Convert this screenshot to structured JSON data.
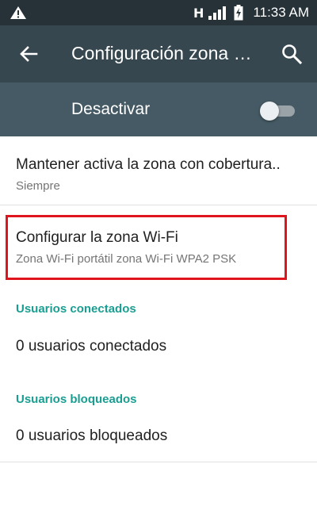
{
  "status_bar": {
    "network": "H",
    "time": "11:33 AM"
  },
  "app_bar": {
    "title": "Configuración zona Wi-Fi",
    "back_icon": "arrow-back-icon",
    "search_icon": "search-icon"
  },
  "hotspot_toggle": {
    "label": "Desactivar",
    "state": "off"
  },
  "preferences": {
    "keep_active": {
      "title": "Mantener activa la zona con cobertura..",
      "summary": "Siempre"
    },
    "configure": {
      "title": "Configurar la zona Wi-Fi",
      "summary": "Zona Wi-Fi portátil zona Wi-Fi WPA2 PSK",
      "highlight_color": "#e0141c"
    }
  },
  "connected": {
    "header": "Usuarios conectados",
    "value": "0 usuarios conectados"
  },
  "blocked": {
    "header": "Usuarios bloqueados",
    "value": "0 usuarios bloqueados"
  },
  "colors": {
    "status_bar": "#263238",
    "app_bar": "#37474f",
    "toggle_bar": "#455a64",
    "accent": "#1a9e91"
  }
}
